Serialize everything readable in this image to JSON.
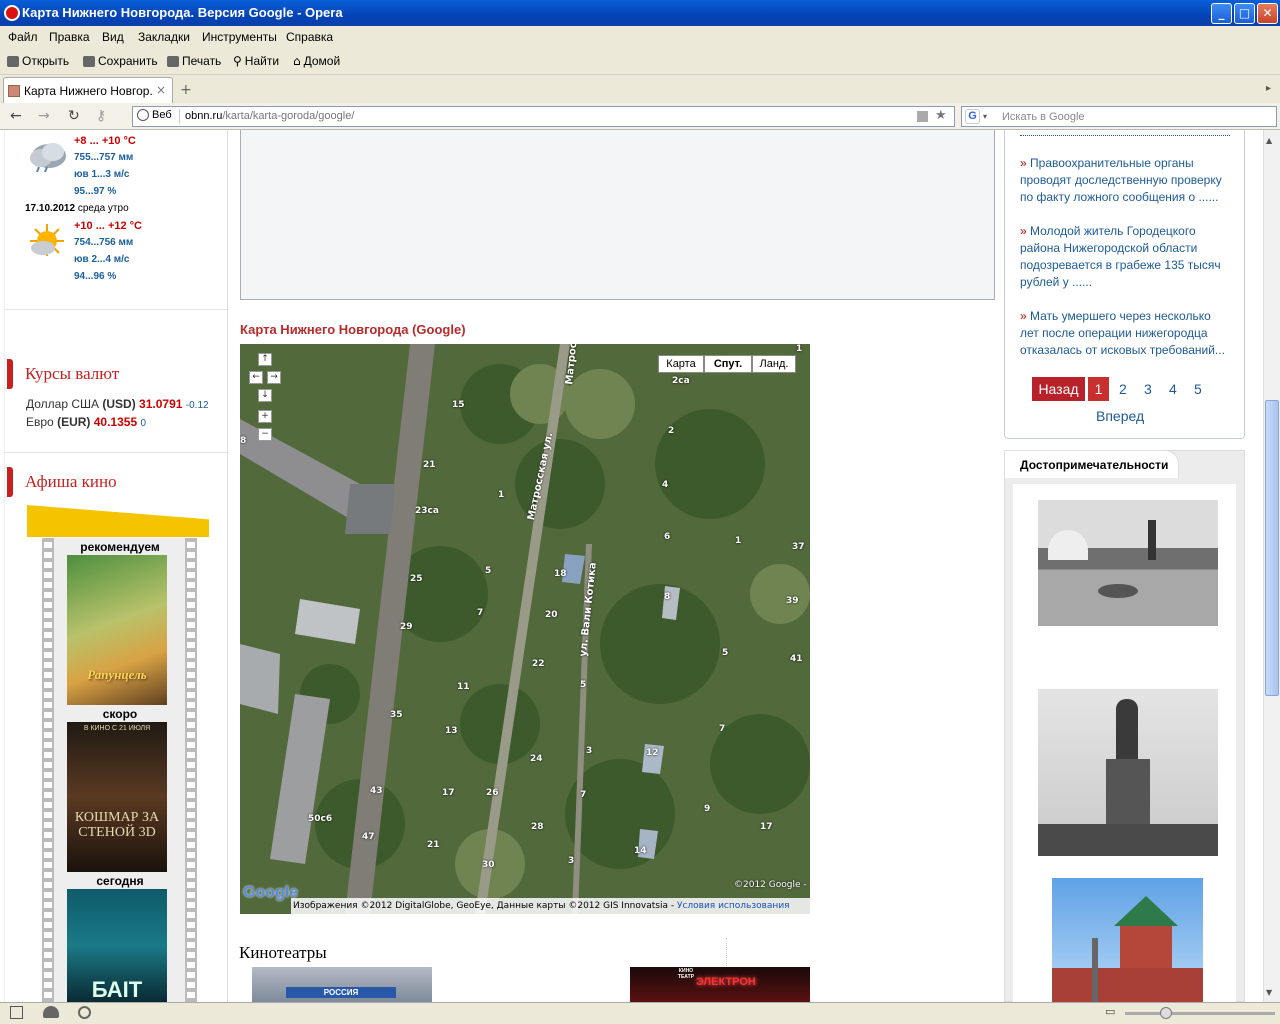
{
  "window": {
    "title": "Карта Нижнего Новгорода. Версия Google - Opera",
    "min": "_",
    "max": "□",
    "close": "✕"
  },
  "menu": [
    "Файл",
    "Правка",
    "Вид",
    "Закладки",
    "Инструменты",
    "Справка"
  ],
  "toolbar": {
    "open": "Открыть",
    "save": "Сохранить",
    "print": "Печать",
    "find": "Найти",
    "home": "Домой"
  },
  "tab": {
    "title": "Карта Нижнего Новгор...",
    "close": "×",
    "new": "+"
  },
  "address": {
    "web": "Веб",
    "host": "obnn.ru",
    "path": "/karta/karta-goroda/google/"
  },
  "search": {
    "placeholder": "Искать в Google",
    "engine": "G"
  },
  "weather": [
    {
      "date": "",
      "temp": "+8 ... +10 °C",
      "pressure": "755...757 мм",
      "wind": "юв 1...3 м/с",
      "humidity": "95...97 %"
    },
    {
      "date": "17.10.2012",
      "day": "среда утро",
      "temp": "+10 ... +12 °C",
      "pressure": "754...756 мм",
      "wind": "юв 2...4 м/с",
      "humidity": "94...96 %"
    }
  ],
  "currency": {
    "title": "Курсы валют",
    "usd": {
      "label": "Доллар США",
      "code": "(USD)",
      "value": "31.0791",
      "change": "-0.12"
    },
    "eur": {
      "label": "Евро",
      "code": "(EUR)",
      "value": "40.1355",
      "change": "0"
    }
  },
  "cinema": {
    "title": "Афиша кино",
    "recommend": "рекомендуем",
    "soon": "скоро",
    "today": "сегодня",
    "poster1": "Рапунцель",
    "poster2_top": "В КИНО С 21 ИЮЛЯ",
    "poster2": "КОШМАР ЗА СТЕНОЙ 3D",
    "poster3": "БАIT"
  },
  "center": {
    "map_title": "Карта Нижнего Новгорода (Google)",
    "cinemas_title": "Кинотеатры",
    "electron": "ЭЛЕКТРОН",
    "russia": "РОССИЯ",
    "kino": "КИНО ТЕАТР"
  },
  "map": {
    "btn_map": "Карта",
    "btn_sat": "Спут.",
    "btn_land": "Ланд.",
    "copyright1": "©2012 Google -",
    "copyright2": "Изображения ©2012 DigitalGlobe, GeoEye, Данные карты ©2012 GIS Innovatsia -",
    "terms": "Условия использования",
    "logo": "Google",
    "street1": "Матросская ул.",
    "street2": "ул. Вали Котика",
    "street3": "Матрос",
    "labels": [
      "15",
      "21",
      "23са",
      "1",
      "25",
      "29",
      "5",
      "7",
      "18",
      "20",
      "22",
      "11",
      "13",
      "35",
      "43",
      "17",
      "26",
      "24",
      "28",
      "21",
      "30",
      "47",
      "50с6",
      "3",
      "12",
      "2",
      "4",
      "6",
      "1",
      "8",
      "5",
      "7",
      "9",
      "17",
      "14",
      "37",
      "39",
      "41",
      "2са",
      "8",
      "1",
      "5",
      "7",
      "3"
    ]
  },
  "news": [
    {
      "text": "Правоохранительные органы проводят доследственную проверку по факту ложного сообщения о ......"
    },
    {
      "text": "Молодой житель Городецкого района Нижегородской области подозревается в грабеже 135 тысяч рублей у ......"
    },
    {
      "text": "Мать умершего через несколько лет после операции нижегородца отказалась от исковых требований..."
    }
  ],
  "pager": {
    "back": "Назад",
    "p1": "1",
    "p2": "2",
    "p3": "3",
    "p4": "4",
    "p5": "5",
    "forward": "Вперед"
  },
  "sights": {
    "tab": "Достопримечательности"
  }
}
